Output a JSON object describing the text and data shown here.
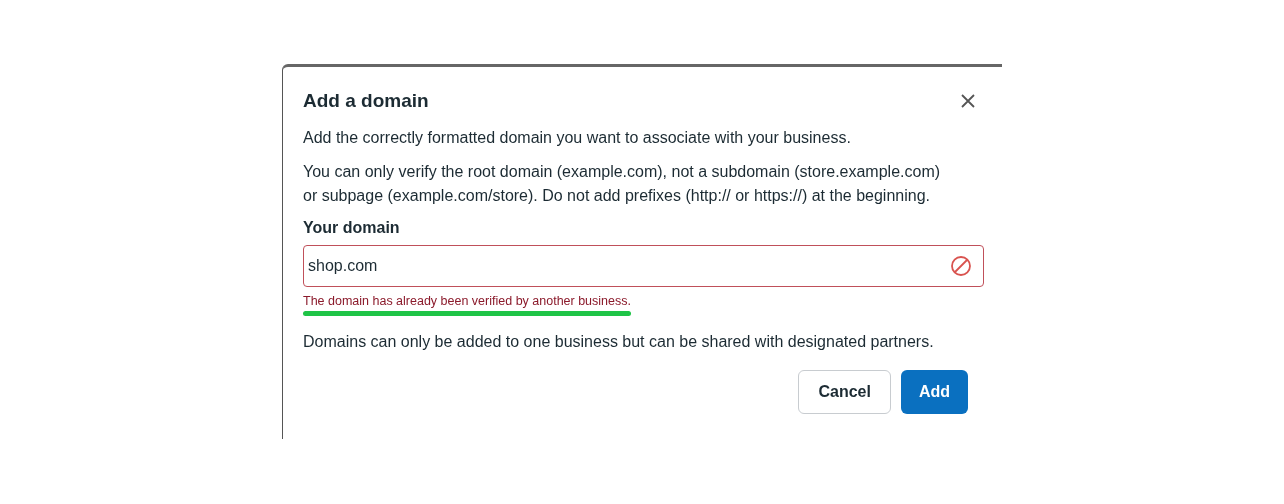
{
  "dialog": {
    "title": "Add a domain",
    "paragraphs": [
      "Add the correctly formatted domain you want to associate with your business.",
      "You can only verify the root domain (example.com), not a subdomain (store.example.com) or subpage (example.com/store). Do not add prefixes (http:// or https://) at the beginning."
    ],
    "field": {
      "label": "Your domain",
      "value": "shop.com",
      "error": true,
      "error_message": "The domain has already been verified by another business.",
      "error_underlined": true
    },
    "note": "Domains can only be added to one business but can be shared with designated partners.",
    "buttons": [
      {
        "label": "Cancel",
        "kind": "secondary"
      },
      {
        "label": "Add",
        "kind": "primary"
      }
    ]
  }
}
